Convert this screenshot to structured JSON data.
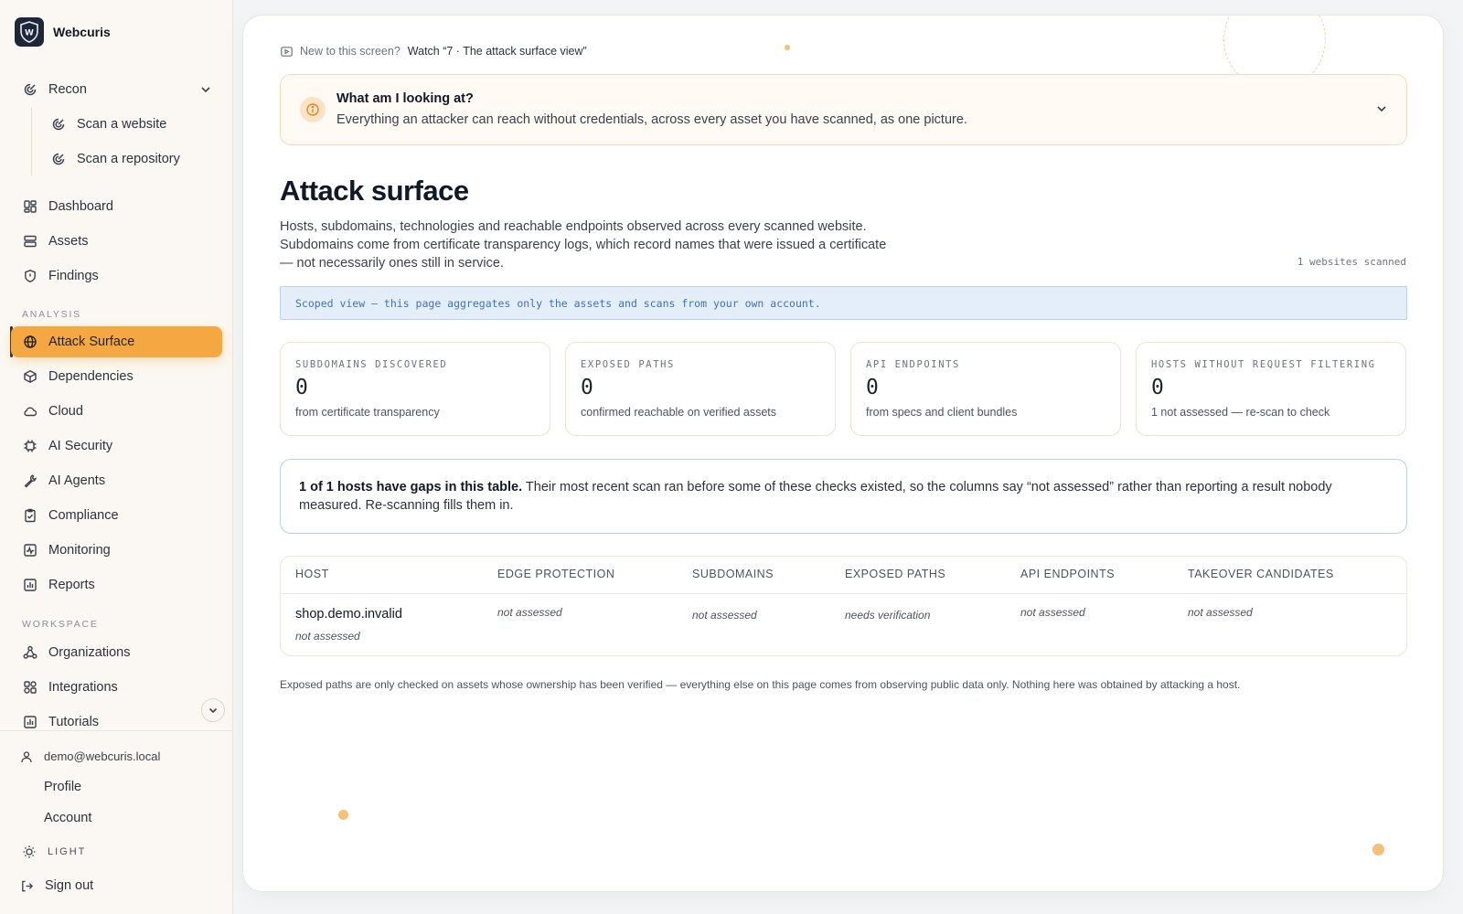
{
  "brand": {
    "name": "Webcuris",
    "logo_letter": "W"
  },
  "sidebar": {
    "recon": {
      "label": "Recon",
      "children": [
        {
          "label": "Scan a website",
          "icon": "radar-icon"
        },
        {
          "label": "Scan a repository",
          "icon": "radar-icon"
        }
      ]
    },
    "main_items": [
      {
        "label": "Dashboard",
        "icon": "dashboard-icon"
      },
      {
        "label": "Assets",
        "icon": "server-icon"
      },
      {
        "label": "Findings",
        "icon": "shield-icon"
      }
    ],
    "analysis_label": "ANALYSIS",
    "analysis_items": [
      {
        "label": "Attack Surface",
        "icon": "globe-icon",
        "active": true
      },
      {
        "label": "Dependencies",
        "icon": "package-icon"
      },
      {
        "label": "Cloud",
        "icon": "cloud-icon"
      },
      {
        "label": "AI Security",
        "icon": "chip-icon"
      },
      {
        "label": "AI Agents",
        "icon": "wrench-icon"
      },
      {
        "label": "Compliance",
        "icon": "clipboard-icon"
      },
      {
        "label": "Monitoring",
        "icon": "activity-icon"
      },
      {
        "label": "Reports",
        "icon": "bar-chart-icon"
      }
    ],
    "workspace_label": "WORKSPACE",
    "workspace_items": [
      {
        "label": "Organizations",
        "icon": "network-icon"
      },
      {
        "label": "Integrations",
        "icon": "puzzle-icon"
      },
      {
        "label": "Tutorials",
        "icon": "bar-chart-icon"
      }
    ],
    "user": {
      "email": "demo@webcuris.local",
      "profile": "Profile",
      "account": "Account",
      "theme": "LIGHT",
      "sign_out": "Sign out"
    }
  },
  "tutorial": {
    "prefix": "New to this screen?",
    "link": "Watch “7 · The attack surface view”"
  },
  "explainer": {
    "title": "What am I looking at?",
    "text": "Everything an attacker can reach without credentials, across every asset you have scanned, as one picture."
  },
  "page": {
    "title": "Attack surface",
    "description": "Hosts, subdomains, technologies and reachable endpoints observed across every scanned website. Subdomains come from certificate transparency logs, which record names that were issued a certificate — not necessarily ones still in service.",
    "scan_count": "1 websites scanned",
    "scope_banner": "Scoped view — this page aggregates only the assets and scans from your own account."
  },
  "stats": [
    {
      "label": "SUBDOMAINS DISCOVERED",
      "value": "0",
      "sub": "from certificate transparency"
    },
    {
      "label": "EXPOSED PATHS",
      "value": "0",
      "sub": "confirmed reachable on verified assets"
    },
    {
      "label": "API ENDPOINTS",
      "value": "0",
      "sub": "from specs and client bundles"
    },
    {
      "label": "HOSTS WITHOUT REQUEST FILTERING",
      "value": "0",
      "sub": "1 not assessed — re-scan to check"
    }
  ],
  "gap_notice": {
    "bold": "1 of 1 hosts have gaps in this table.",
    "text": " Their most recent scan ran before some of these checks existed, so the columns say “not assessed” rather than reporting a result nobody measured. Re-scanning fills them in."
  },
  "table": {
    "columns": [
      "HOST",
      "EDGE PROTECTION",
      "SUBDOMAINS",
      "EXPOSED PATHS",
      "API ENDPOINTS",
      "TAKEOVER CANDIDATES"
    ],
    "rows": [
      {
        "host": "shop.demo.invalid",
        "host_note": "not assessed",
        "edge_protection": "not assessed",
        "subdomains": "not assessed",
        "exposed_paths": "needs verification",
        "api_endpoints": "not assessed",
        "takeover_candidates": "not assessed"
      }
    ]
  },
  "footnote": "Exposed paths are only checked on assets whose ownership has been verified — everything else on this page comes from observing public data only. Nothing here was obtained by attacking a host.",
  "colors": {
    "accent": "#f5a742",
    "info_blue": "#3f74b5",
    "sidebar_bg": "#fbf8f3"
  }
}
